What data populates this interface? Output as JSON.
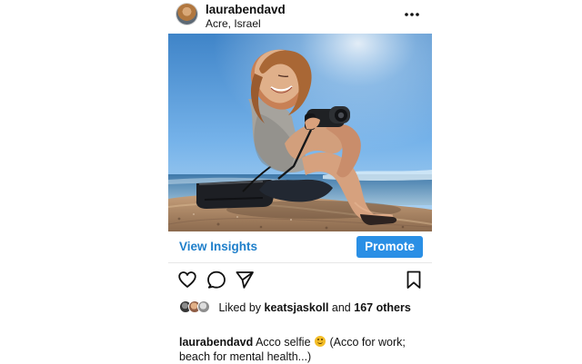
{
  "header": {
    "username": "laurabendavd",
    "location": "Acre, Israel",
    "more_icon": "more-horizontal-icon"
  },
  "photo": {
    "subject": "beach-selfie-photo"
  },
  "insights_bar": {
    "view_insights_label": "View Insights",
    "promote_label": "Promote"
  },
  "actions": {
    "like_icon": "heart-icon",
    "comment_icon": "comment-icon",
    "share_icon": "share-icon",
    "save_icon": "bookmark-icon"
  },
  "likes": {
    "prefix": "Liked by",
    "user": "keatsjaskoll",
    "connector": "and",
    "count_text": "167 others"
  },
  "caption": {
    "username": "laurabendavd",
    "text_before_emoji": "Acco selfie",
    "emoji": "smiling-face",
    "text_after_emoji": "(Acco for work; beach for mental health...)"
  },
  "colors": {
    "link_blue": "#1f7fca",
    "promote_blue": "#2a8fe5",
    "text": "#111111",
    "divider": "#e6e6e6"
  }
}
